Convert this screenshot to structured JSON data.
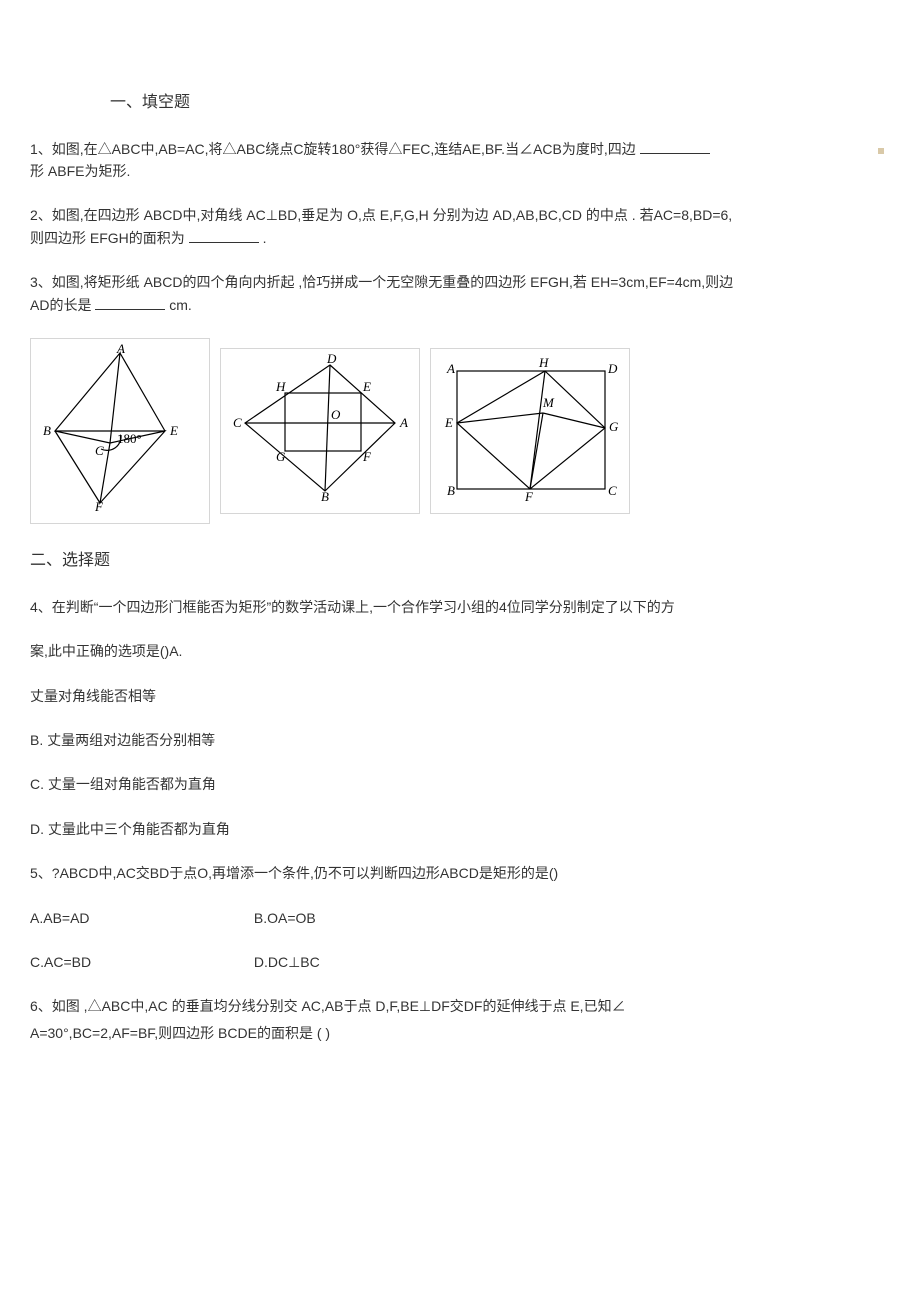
{
  "sections": {
    "s1_title": "一、填空题",
    "s2_title": "二、选择题"
  },
  "q1": {
    "line1_a": "1、如图,在△ABC中,AB=AC,将△ABC绕点C旋转180°获得△FEC,连结AE,BF.当∠ACB为度时,四边",
    "line2": "形 ABFE为矩形."
  },
  "q2": {
    "line1": "2、如图,在四边形    ABCD中,对角线    AC⊥BD,垂足为   O,点 E,F,G,H 分别为边   AD,AB,BC,CD 的中点 . 若AC=8,BD=6,",
    "line2_a": "则四边形   EFGH的面积为",
    "line2_b": "."
  },
  "q3": {
    "line1": "3、如图,将矩形纸     ABCD的四个角向内折起    ,恰巧拼成一个无空隙无重叠的四边形       EFGH,若 EH=3cm,EF=4cm,则边",
    "line2_a": "AD的长是",
    "line2_b": "cm."
  },
  "q4": {
    "line1": "4、在判断“一个四边形门框能否为矩形”的数学活动课上,一个合作学习小组的4位同学分别制定了以下的方",
    "line2": "案,此中正确的选项是()A.",
    "line3": "丈量对角线能否相等",
    "optB": "B. 丈量两组对边能否分别相等",
    "optC": "C. 丈量一组对角能否都为直角",
    "optD": "D. 丈量此中三个角能否都为直角"
  },
  "q5": {
    "stem": "5、?ABCD中,AC交BD于点O,再增添一个条件,仍不可以判断四边形ABCD是矩形的是()",
    "optA": "A.AB=AD",
    "optB": "B.OA=OB",
    "optC": "C.AC=BD",
    "optD": "D.DC⊥BC"
  },
  "q6": {
    "line1": "6、如图  ,△ABC中,AC  的垂直均分线分别交     AC,AB于点   D,F,BE⊥DF交DF的延伸线于点       E,已知∠",
    "line2": "A=30°,BC=2,AF=BF,则四边形     BCDE的面积是  (        )"
  },
  "figures": {
    "f1": {
      "A": "A",
      "B": "B",
      "C": "C",
      "E": "E",
      "F": "F",
      "ang": "180°"
    },
    "f2": {
      "A": "A",
      "B": "B",
      "C": "C",
      "D": "D",
      "E": "E",
      "F": "F",
      "G": "G",
      "H": "H",
      "O": "O"
    },
    "f3": {
      "A": "A",
      "B": "B",
      "C": "C",
      "D": "D",
      "E": "E",
      "F": "F",
      "G": "G",
      "H": "H",
      "M": "M"
    }
  }
}
